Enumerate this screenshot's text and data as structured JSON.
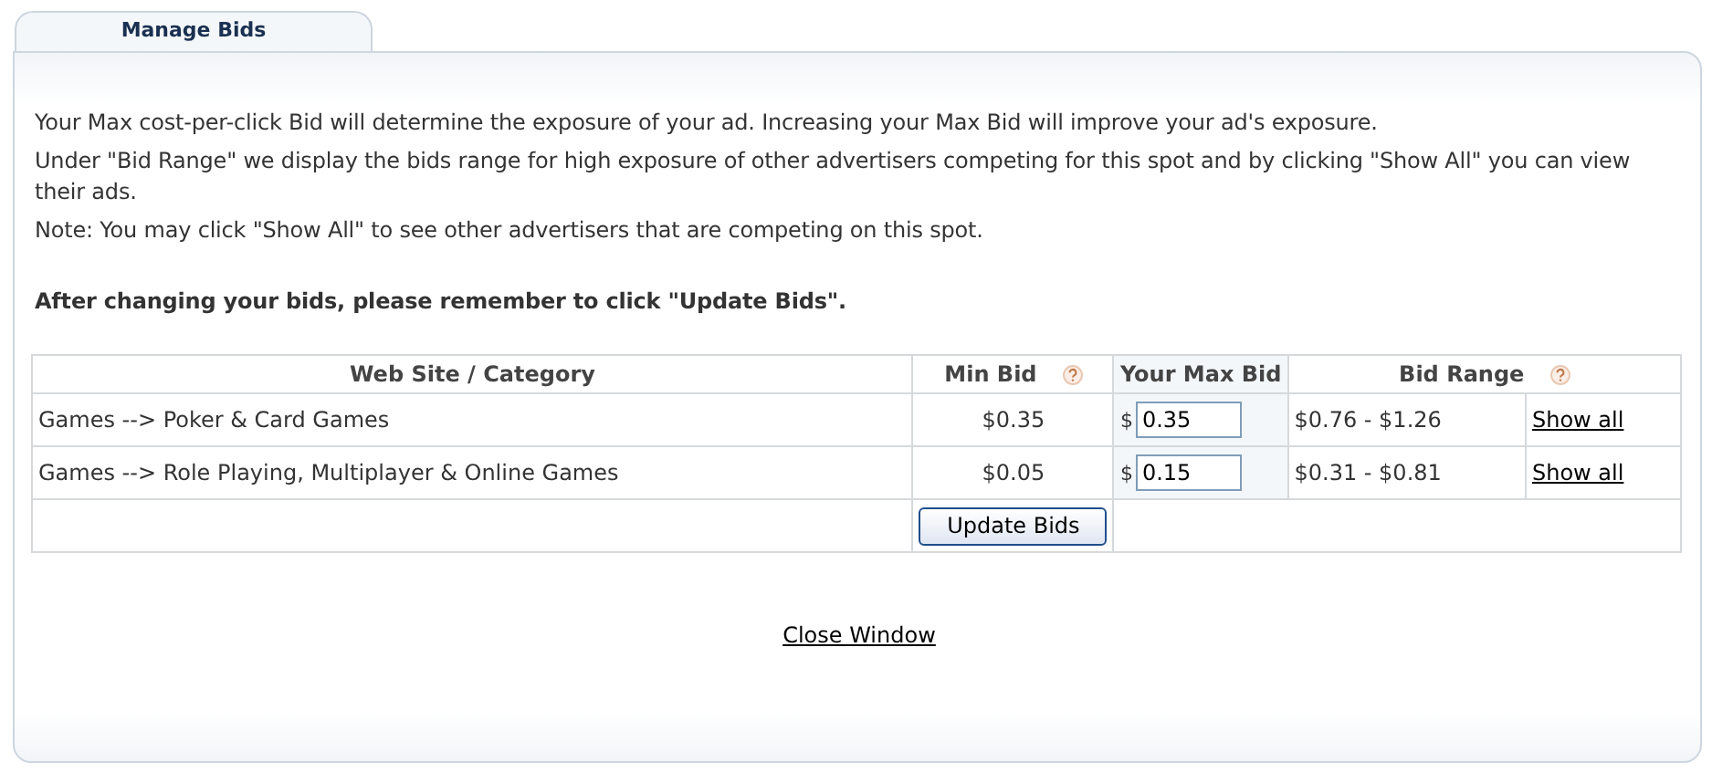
{
  "tab": {
    "label": "Manage Bids",
    "selected": true
  },
  "intro": [
    "Your Max cost-per-click Bid will determine the exposure of your ad. Increasing your Max Bid will improve your ad's exposure.",
    "Under \"Bid Range\" we display the bids range for high exposure of other advertisers competing for this spot and by clicking \"Show All\" you can view their ads.",
    "Note: You may click \"Show All\" to see other advertisers that are competing on this spot."
  ],
  "reminder": "After changing your bids, please remember to click \"Update Bids\".",
  "table": {
    "columns": [
      {
        "label": "Web Site / Category",
        "help": false
      },
      {
        "label": "Min Bid",
        "help": true
      },
      {
        "label": "Your Max Bid",
        "help": false
      },
      {
        "label": "Bid Range",
        "help": true
      }
    ],
    "rows": [
      {
        "category": "Games --> Poker & Card Games",
        "min_bid": "$0.35",
        "currency": "$",
        "max_bid": "0.35",
        "bid_range": "$0.76 - $1.26",
        "link": "Show all"
      },
      {
        "category": "Games --> Role Playing, Multiplayer & Online Games",
        "min_bid": "$0.05",
        "currency": "$",
        "max_bid": "0.15",
        "bid_range": "$0.31 - $0.81",
        "link": "Show all"
      }
    ],
    "button": "Update Bids"
  },
  "close_link": "Close Window"
}
